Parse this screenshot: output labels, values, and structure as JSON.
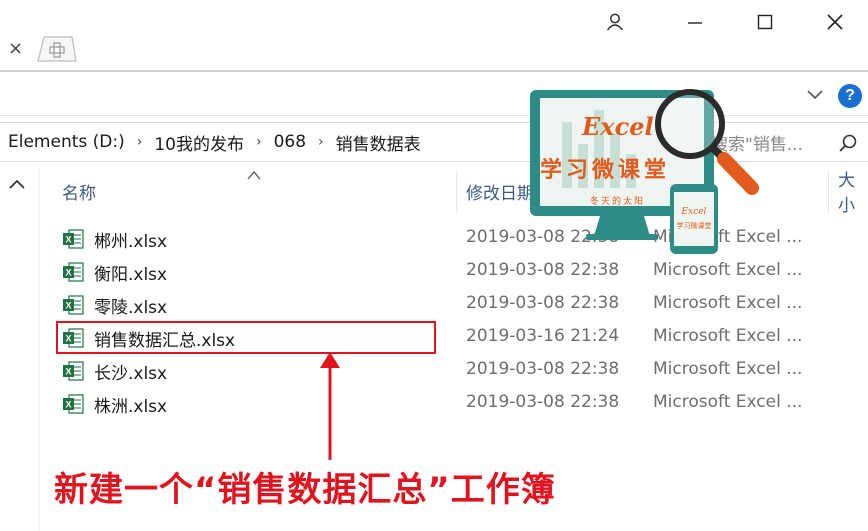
{
  "window": {
    "minimize_label": "—",
    "maximize_label": "☐",
    "close_label": "✕"
  },
  "tabs": {
    "close_label": "×"
  },
  "ribbon": {
    "help_label": "?"
  },
  "address": {
    "crumbs": [
      "Elements (D:)",
      "10我的发布",
      "068",
      "销售数据表"
    ]
  },
  "search": {
    "placeholder": "搜索\"销售..."
  },
  "columns": {
    "name": "名称",
    "date": "修改日期",
    "size": "大小"
  },
  "files": [
    {
      "name": "郴州.xlsx",
      "date": "2019-03-08 22:38",
      "type": "Microsoft Excel ..."
    },
    {
      "name": "衡阳.xlsx",
      "date": "2019-03-08 22:38",
      "type": "Microsoft Excel ..."
    },
    {
      "name": "零陵.xlsx",
      "date": "2019-03-08 22:38",
      "type": "Microsoft Excel ..."
    },
    {
      "name": "销售数据汇总.xlsx",
      "date": "2019-03-16 21:24",
      "type": "Microsoft Excel ..."
    },
    {
      "name": "长沙.xlsx",
      "date": "2019-03-08 22:38",
      "type": "Microsoft Excel ..."
    },
    {
      "name": "株洲.xlsx",
      "date": "2019-03-08 22:38",
      "type": "Microsoft Excel ..."
    }
  ],
  "annotation": {
    "caption": "新建一个“销售数据汇总”工作簿",
    "color": "#e0141e"
  },
  "logo": {
    "title": "Excel",
    "subtitle": "学习微课堂",
    "signature": "冬天的太阳",
    "phone_title": "Excel",
    "phone_subtitle": "学习微课堂"
  },
  "colors": {
    "accent": "#1a6fd0",
    "excel_green": "#1f7244",
    "logo_teal": "#2e8c87",
    "logo_orange": "#e25a1c"
  }
}
